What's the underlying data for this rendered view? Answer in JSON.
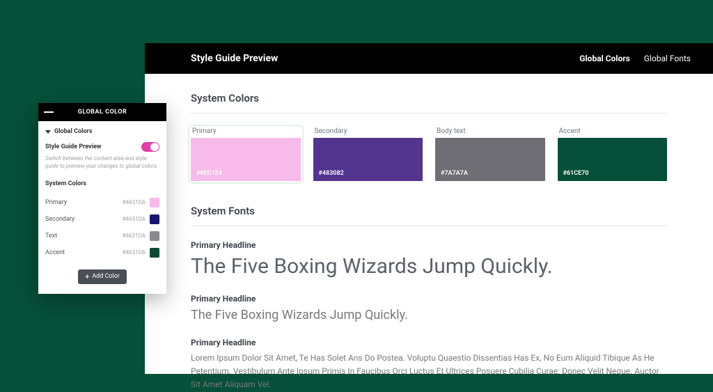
{
  "main": {
    "title": "Style Guide Preview",
    "nav": [
      {
        "label": "Global Colors",
        "active": true
      },
      {
        "label": "Global Fonts",
        "active": false
      }
    ],
    "systemColorsTitle": "System Colors",
    "swatches": [
      {
        "label": "Primary",
        "hex": "#6EC1E4",
        "bg": "#f7baea",
        "selected": true
      },
      {
        "label": "Secondary",
        "hex": "#483082",
        "bg": "#53348f",
        "selected": false
      },
      {
        "label": "Body text",
        "hex": "#7A7A7A",
        "bg": "#6e6e74",
        "selected": false
      },
      {
        "label": "Accent",
        "hex": "#61CE70",
        "bg": "#064f39",
        "selected": false
      }
    ],
    "systemFontsTitle": "System Fonts",
    "fontBlocks": [
      {
        "label": "Primary Headline",
        "sample": "The Five Boxing Wizards Jump Quickly.",
        "size": "lg"
      },
      {
        "label": "Primary Headline",
        "sample": "The Five Boxing Wizards Jump Quickly.",
        "size": "md"
      },
      {
        "label": "Primary Headline",
        "sample": "Lorem Ipsum Dolor Sit Amet, Te Has Solet Ans Do Postea. Voluptu Quaestio Dissentias Has Ex, No Eum Aliquid Tibique As He Petentium. Vestibulum Ante Ipsum Primis In Faucibus Orci Luctus Et Ultrices Posuere Cubilia Curae: Donec Velit Neque. Auctor Sit Amet Aliquam Vel.",
        "size": "body"
      }
    ]
  },
  "panel": {
    "headerTitle": "GLOBAL COLOR",
    "dropdownLabel": "Global Colors",
    "toggleLabel": "Style Guide Preview",
    "hint": "Switch between the content area and style guide to preview your changes to global colors.",
    "subtitle": "System Colors",
    "rows": [
      {
        "name": "Primary",
        "hex": "#4631DA",
        "chip": "#f7baea"
      },
      {
        "name": "Secondary",
        "hex": "#4631DA",
        "chip": "#17156f"
      },
      {
        "name": "Text",
        "hex": "#4631DA",
        "chip": "#8a8a90"
      },
      {
        "name": "Accent",
        "hex": "#4631DA",
        "chip": "#0a4a34"
      }
    ],
    "addLabel": "Add Color"
  }
}
